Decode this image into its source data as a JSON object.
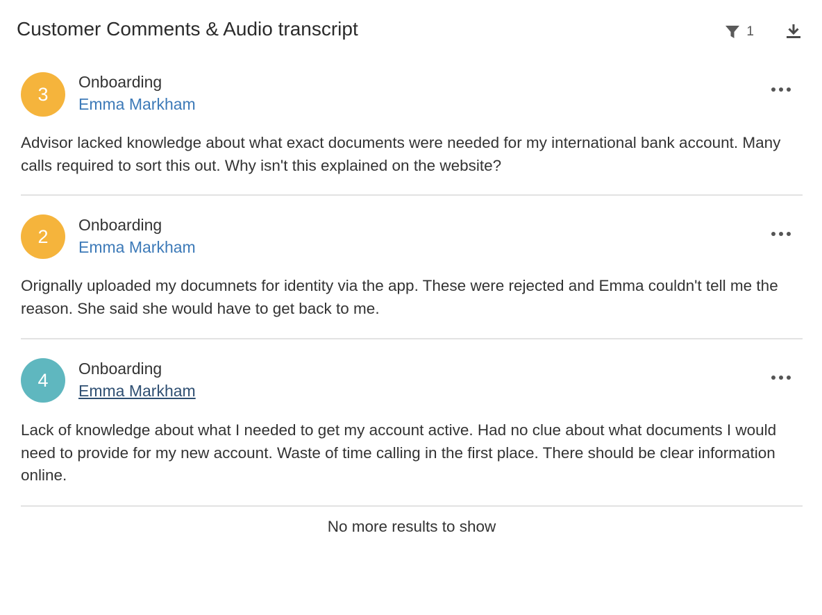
{
  "panel": {
    "title": "Customer Comments & Audio transcript",
    "filter_count": "1",
    "filter_icon": "filter-icon",
    "download_icon": "download-icon"
  },
  "colors": {
    "score_orange": "#f5b43c",
    "score_teal": "#5fb7bf",
    "link_blue": "#3d7ab8"
  },
  "comments": [
    {
      "score": "3",
      "score_color": "#f5b43c",
      "category": "Onboarding",
      "advisor": "Emma Markham",
      "text": "Advisor lacked knowledge about what exact documents were needed for my international bank account. Many calls required to sort this out. Why isn't this explained on the website?"
    },
    {
      "score": "2",
      "score_color": "#f5b43c",
      "category": "Onboarding",
      "advisor": "Emma Markham",
      "text": "Orignally uploaded my documnets for identity via the app. These were rejected and Emma couldn't tell me the reason. She said she would have to get back to me."
    },
    {
      "score": "4",
      "score_color": "#5fb7bf",
      "category": "Onboarding",
      "advisor": "Emma Markham",
      "text": "Lack of knowledge about what I needed to get my account active. Had no clue about what documents I would need to provide for my new account. Waste of time calling in the first place. There should be clear information online."
    }
  ],
  "footer": {
    "message": "No more results to show"
  }
}
